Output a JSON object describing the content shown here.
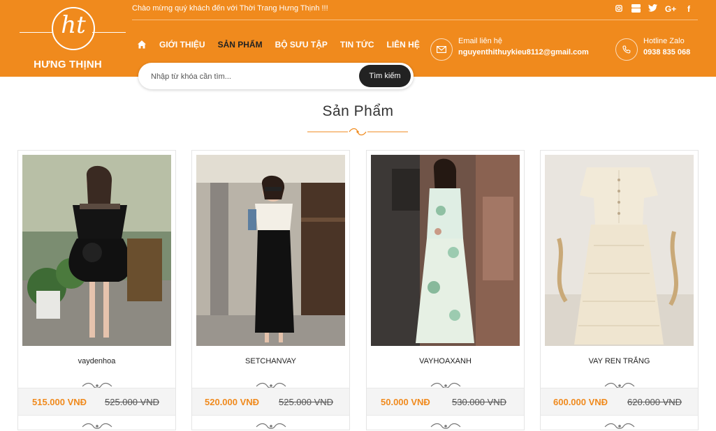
{
  "brand": {
    "monogram": "ht",
    "name": "HƯNG THỊNH"
  },
  "topbar": {
    "welcome": "Chào mừng quý khách đến với Thời Trang Hưng Thịnh !!!"
  },
  "social": [
    "instagram-icon",
    "youtube-icon",
    "twitter-icon",
    "google-plus-icon",
    "facebook-icon"
  ],
  "nav": {
    "items": [
      "GIỚI THIỆU",
      "SẢN PHẨM",
      "BỘ SƯU TẬP",
      "TIN TỨC",
      "LIÊN HỆ"
    ],
    "active": "SẢN PHẨM"
  },
  "contact": {
    "email_label": "Email liên hệ",
    "email_value": "nguyenthithuykieu8112@gmail.com",
    "hotline_label": "Hotline Zalo",
    "hotline_value": "0938 835 068"
  },
  "search": {
    "placeholder": "Nhập từ khóa cần tìm...",
    "button_label": "Tìm kiếm"
  },
  "section": {
    "title": "Sản Phẩm"
  },
  "products": [
    {
      "name": "vaydenhoa",
      "price": "515.000 VNĐ",
      "old_price": "525.000 VNĐ"
    },
    {
      "name": "SETCHANVAY",
      "price": "520.000 VNĐ",
      "old_price": "525.000 VNĐ"
    },
    {
      "name": "VAYHOAXANH",
      "price": "50.000 VNĐ",
      "old_price": "530.000 VNĐ"
    },
    {
      "name": "VAY REN TRẮNG",
      "price": "600.000 VNĐ",
      "old_price": "620.000 VNĐ"
    }
  ],
  "colors": {
    "brand_orange": "#f08a1d",
    "dark": "#222222"
  }
}
